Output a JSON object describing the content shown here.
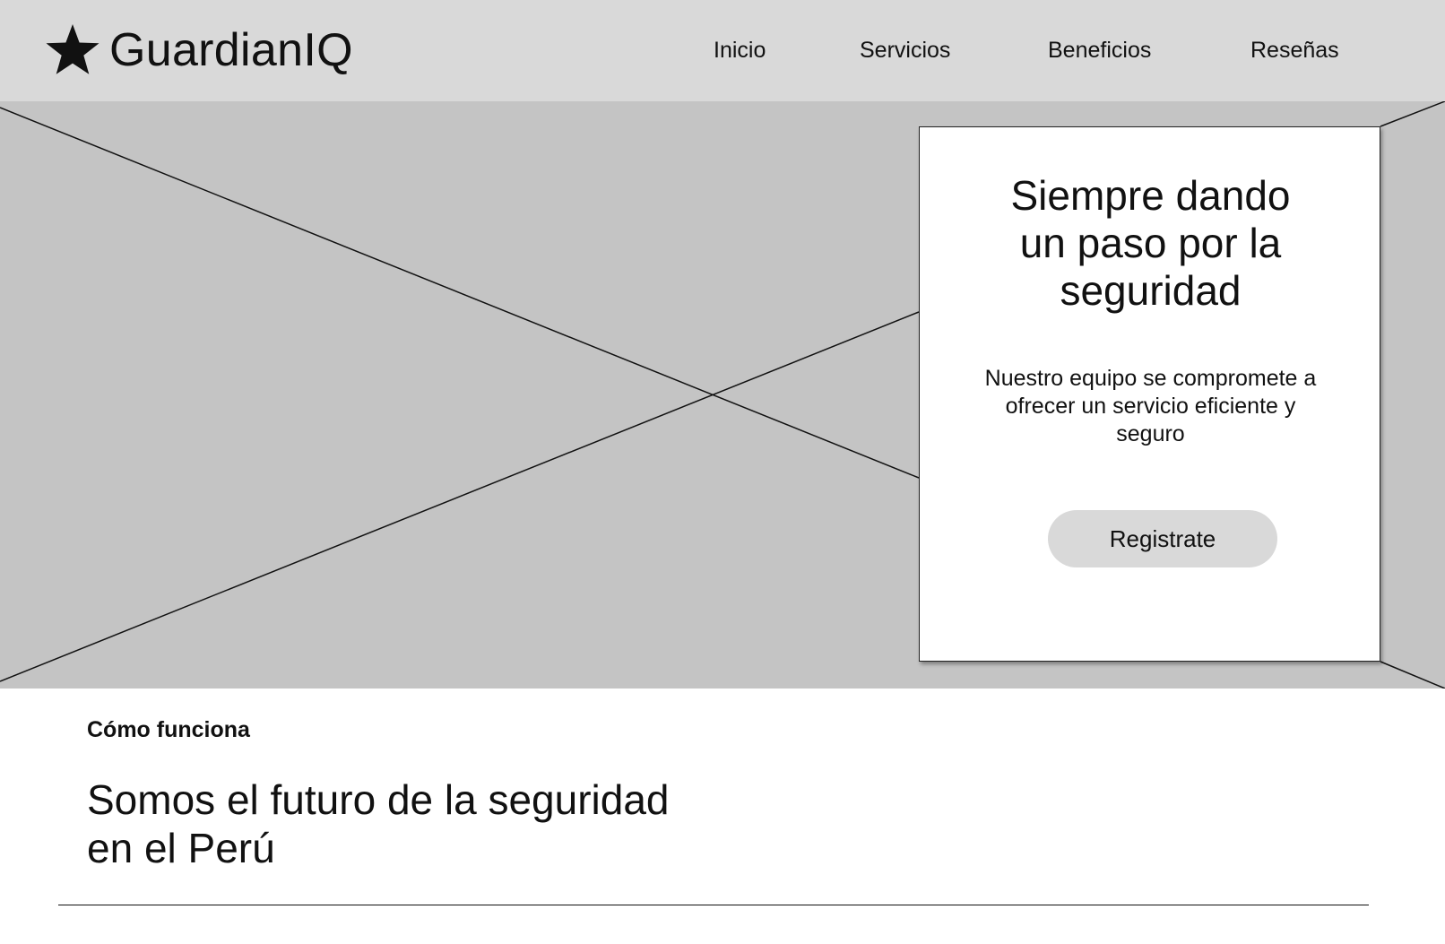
{
  "header": {
    "logo_icon": "star-icon",
    "brand": "GuardianIQ",
    "nav": [
      {
        "label": "Inicio"
      },
      {
        "label": "Servicios"
      },
      {
        "label": "Beneficios"
      },
      {
        "label": "Reseñas"
      }
    ],
    "background": "#d9d9d9"
  },
  "hero": {
    "placeholder_icon": "image-placeholder",
    "background": "#c4c4c4",
    "card": {
      "title": "Siempre dando\nun paso por la\nseguridad",
      "text": "Nuestro equipo se compromete a\nofrecer un servicio eficiente y\nseguro",
      "button_label": "Registrate",
      "button_color": "#d9d9d9"
    }
  },
  "section": {
    "label": "Cómo funciona",
    "heading": "Somos el futuro de la seguridad\nen el Perú"
  }
}
